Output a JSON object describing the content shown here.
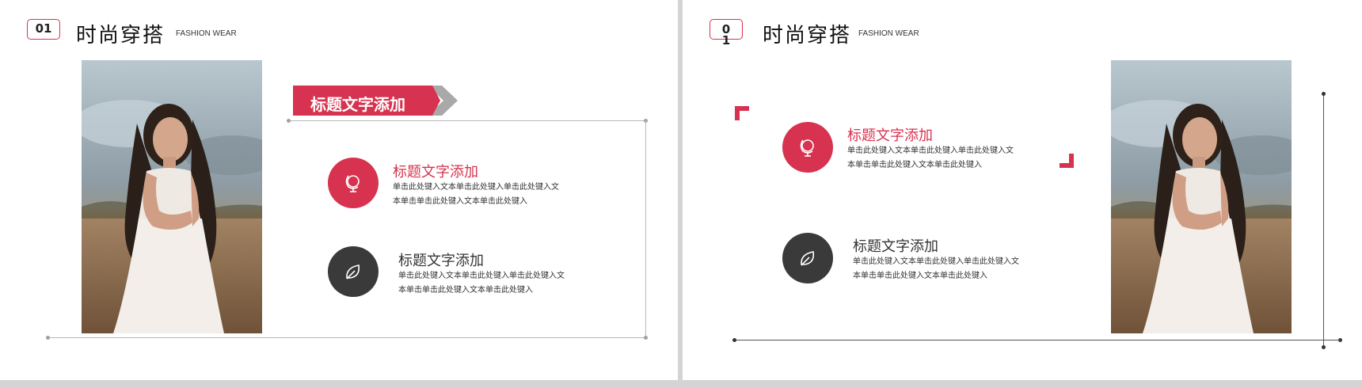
{
  "colors": {
    "accent": "#d7324f",
    "dark": "#3a3a3a",
    "line": "#b8b8b8"
  },
  "slide1": {
    "number": "01",
    "title": "时尚穿搭",
    "subtitle": "FASHION WEAR",
    "banner": "标题文字添加",
    "items": [
      {
        "icon": "globe-icon",
        "title": "标题文字添加",
        "body_line1": "单击此处键入文本单击此处键入单击此处键入文",
        "body_line2": "本单击单击此处键入文本单击此处键入"
      },
      {
        "icon": "leaf-icon",
        "title": "标题文字添加",
        "body_line1": "单击此处键入文本单击此处键入单击此处键入文",
        "body_line2": "本单击单击此处键入文本单击此处键入"
      }
    ]
  },
  "slide2": {
    "number_line1": "0",
    "number_line2": "1",
    "title": "时尚穿搭",
    "subtitle": "FASHION WEAR",
    "items": [
      {
        "icon": "globe-icon",
        "title": "标题文字添加",
        "body_line1": "单击此处键入文本单击此处键入单击此处键入文",
        "body_line2": "本单击单击此处键入文本单击此处键入"
      },
      {
        "icon": "leaf-icon",
        "title": "标题文字添加",
        "body_line1": "单击此处键入文本单击此处键入单击此处键入文",
        "body_line2": "本单击单击此处键入文本单击此处键入"
      }
    ]
  }
}
